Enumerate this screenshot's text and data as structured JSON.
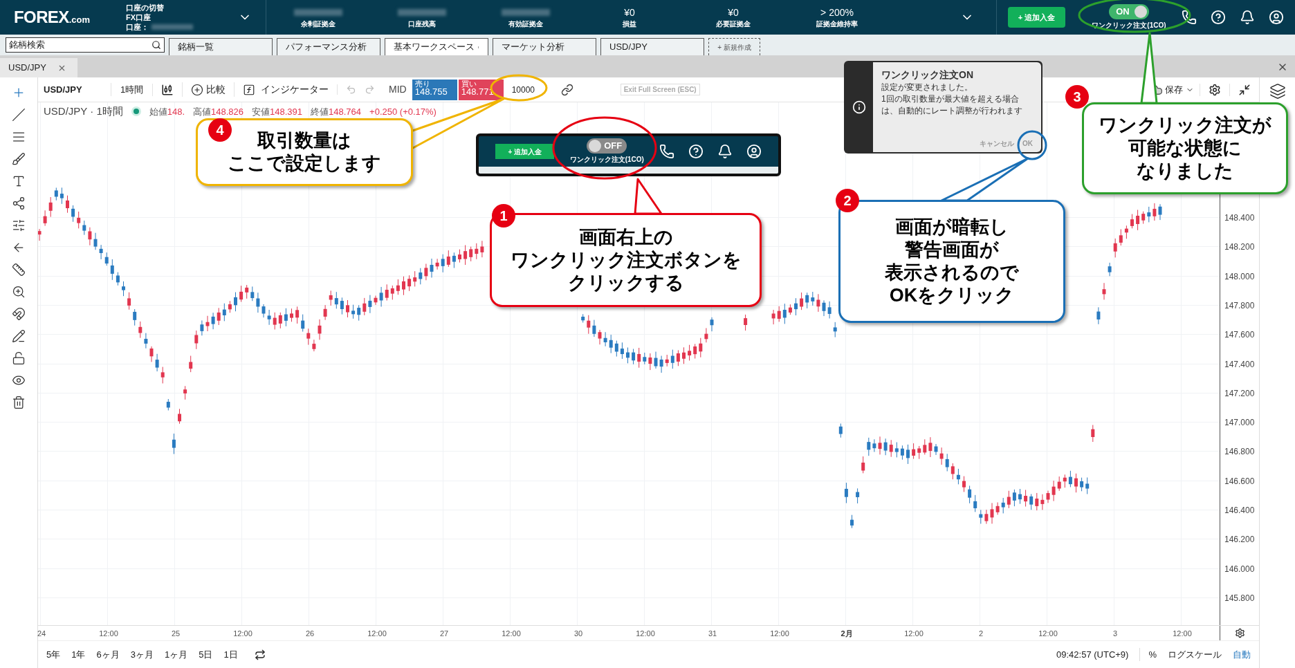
{
  "header": {
    "logo": {
      "main": "FOREX",
      "suffix": ".com"
    },
    "account_switch": "口座の切替",
    "account_type": "FX口座",
    "account_label": "口座：",
    "stats": [
      {
        "label": "余剰証拠金"
      },
      {
        "label": "口座残高"
      },
      {
        "label": "有効証拠金"
      },
      {
        "label": "損益",
        "value": "¥0"
      },
      {
        "label": "必要証拠金",
        "value": "¥0"
      },
      {
        "label": "証拠金維持率",
        "value": "> 200%"
      }
    ],
    "deposit_button": "+ 追加入金",
    "one_click": {
      "label": "ワンクリック注文(1CO)",
      "on": true,
      "state_text": "ON"
    }
  },
  "workspace_tabs": {
    "search_placeholder": "銘柄検索",
    "tabs": [
      {
        "label": "銘柄一覧",
        "selected": false
      },
      {
        "label": "パフォーマンス分析",
        "selected": false
      },
      {
        "label": "基本ワークスペース",
        "selected": true
      },
      {
        "label": "マーケット分析",
        "selected": false
      },
      {
        "label": "USD/JPY",
        "selected": false
      }
    ],
    "new_tab": "+ 新規作成"
  },
  "chart_tab": {
    "label": "USD/JPY"
  },
  "toolbar": {
    "symbol": "USD/JPY",
    "interval": "1時間",
    "compare": "比較",
    "indicators": "インジケーター",
    "price_type": "MID",
    "sell": {
      "label": "売り",
      "price": "148.755"
    },
    "buy": {
      "label": "買い",
      "price": "148.771"
    },
    "quantity": "10000",
    "exit_fullscreen": "Exit Full Screen (ESC)",
    "save": "保存"
  },
  "legend": {
    "title": "USD/JPY · 1時間",
    "values": [
      {
        "label": "始値",
        "value": "148."
      },
      {
        "label": "高値",
        "value": "148.826"
      },
      {
        "label": "安値",
        "value": "148.391"
      },
      {
        "label": "終値",
        "value": "148.764"
      }
    ],
    "change": "+0.250 (+0.17%)"
  },
  "price_axis": [
    "148.400",
    "148.200",
    "148.000",
    "147.800",
    "147.600",
    "147.400",
    "147.200",
    "147.000",
    "146.800",
    "146.600",
    "146.400",
    "146.200",
    "146.000",
    "145.800"
  ],
  "time_axis": [
    {
      "label": "24",
      "kind": "day"
    },
    {
      "label": "12:00",
      "kind": "time"
    },
    {
      "label": "25",
      "kind": "day"
    },
    {
      "label": "12:00",
      "kind": "time"
    },
    {
      "label": "26",
      "kind": "day"
    },
    {
      "label": "12:00",
      "kind": "time"
    },
    {
      "label": "27",
      "kind": "day"
    },
    {
      "label": "12:00",
      "kind": "time"
    },
    {
      "label": "30",
      "kind": "day"
    },
    {
      "label": "12:00",
      "kind": "time"
    },
    {
      "label": "31",
      "kind": "day"
    },
    {
      "label": "12:00",
      "kind": "time"
    },
    {
      "label": "2月",
      "kind": "month"
    },
    {
      "label": "12:00",
      "kind": "time"
    },
    {
      "label": "2",
      "kind": "day"
    },
    {
      "label": "12:00",
      "kind": "time"
    },
    {
      "label": "3",
      "kind": "day"
    },
    {
      "label": "12:00",
      "kind": "time"
    }
  ],
  "bottom_bar": {
    "ranges": [
      "5年",
      "1年",
      "6ヶ月",
      "3ヶ月",
      "1ヶ月",
      "5日",
      "1日"
    ],
    "time": "09:42:57 (UTC+9)",
    "percent": "%",
    "log_scale": "ログスケール",
    "auto": {
      "label": "自動",
      "on": true
    }
  },
  "notification": {
    "title": "ワンクリック注文ON",
    "messages": [
      "設定が変更されました。",
      "1回の取引数量が最大値を超える場合は、自動的にレート調整が行われます"
    ],
    "cancel": "キャンセル",
    "ok": "OK"
  },
  "mini_panel": {
    "deposit_button": "+ 追加入金",
    "one_click": {
      "label": "ワンクリック注文(1CO)",
      "on": false,
      "state_text": "OFF"
    }
  },
  "callouts": [
    {
      "number": "4",
      "color": "#f0b400",
      "lines": [
        "取引数量は",
        "ここで設定します"
      ]
    },
    {
      "number": "1",
      "color": "#e60012",
      "lines": [
        "画面右上の",
        "ワンクリック注文ボタンを",
        "クリックする"
      ]
    },
    {
      "number": "2",
      "color": "#1a6fb5",
      "lines": [
        "画面が暗転し",
        "警告画面が",
        "表示されるので",
        "OKをクリック"
      ]
    },
    {
      "number": "3",
      "color": "#2ca02c",
      "lines": [
        "ワンクリック注文が",
        "可能な状態に",
        "なりました"
      ]
    }
  ]
}
